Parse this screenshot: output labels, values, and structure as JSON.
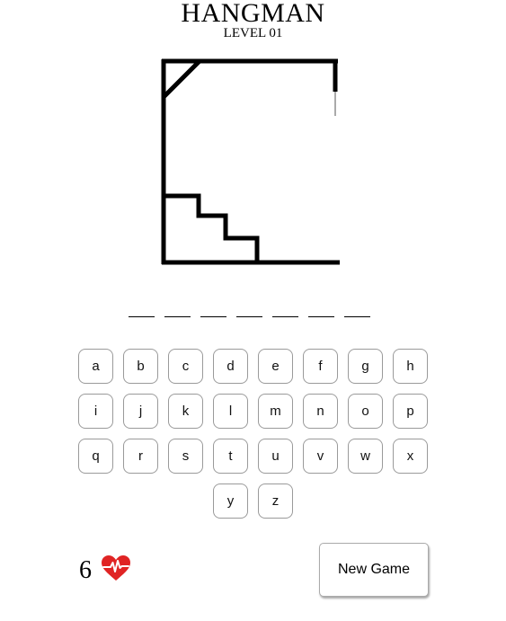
{
  "game": {
    "title": "HANGMAN",
    "level_label": "LEVEL 01"
  },
  "word": {
    "letters": [
      "",
      "",
      "",
      "",
      "",
      "",
      ""
    ]
  },
  "keyboard": {
    "rows": [
      [
        "a",
        "b",
        "c",
        "d",
        "e",
        "f",
        "g",
        "h"
      ],
      [
        "i",
        "j",
        "k",
        "l",
        "m",
        "n",
        "o",
        "p"
      ],
      [
        "q",
        "r",
        "s",
        "t",
        "u",
        "v",
        "w",
        "x"
      ],
      [
        "y",
        "z"
      ]
    ]
  },
  "status": {
    "lives": "6",
    "lives_icon": "heart-pulse-icon",
    "heart_color": "#e02424"
  },
  "controls": {
    "new_game_label": "New Game"
  }
}
